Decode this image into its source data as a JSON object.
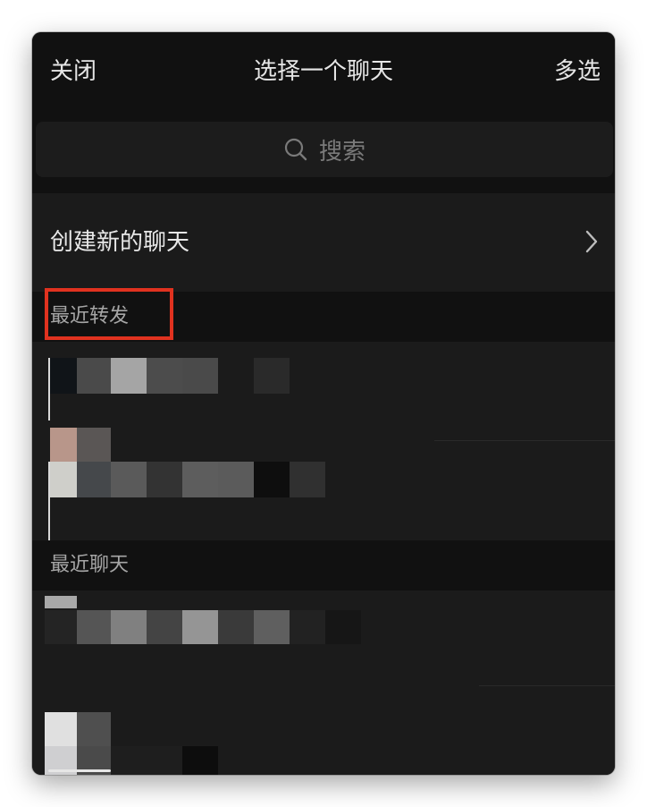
{
  "header": {
    "close_label": "关闭",
    "title": "选择一个聊天",
    "multi_select_label": "多选"
  },
  "search": {
    "placeholder": "搜索",
    "icon": "search-icon"
  },
  "create_chat": {
    "label": "创建新的聊天",
    "icon": "chevron-right-icon"
  },
  "sections": {
    "recent_forwards": {
      "label": "最近转发"
    },
    "recent_chats": {
      "label": "最近聊天"
    }
  },
  "colors": {
    "background": "#111111",
    "row_background": "#1b1b1b",
    "text_primary": "#e6e6e6",
    "text_secondary": "#a6a6a6",
    "highlight": "#e0321f"
  }
}
